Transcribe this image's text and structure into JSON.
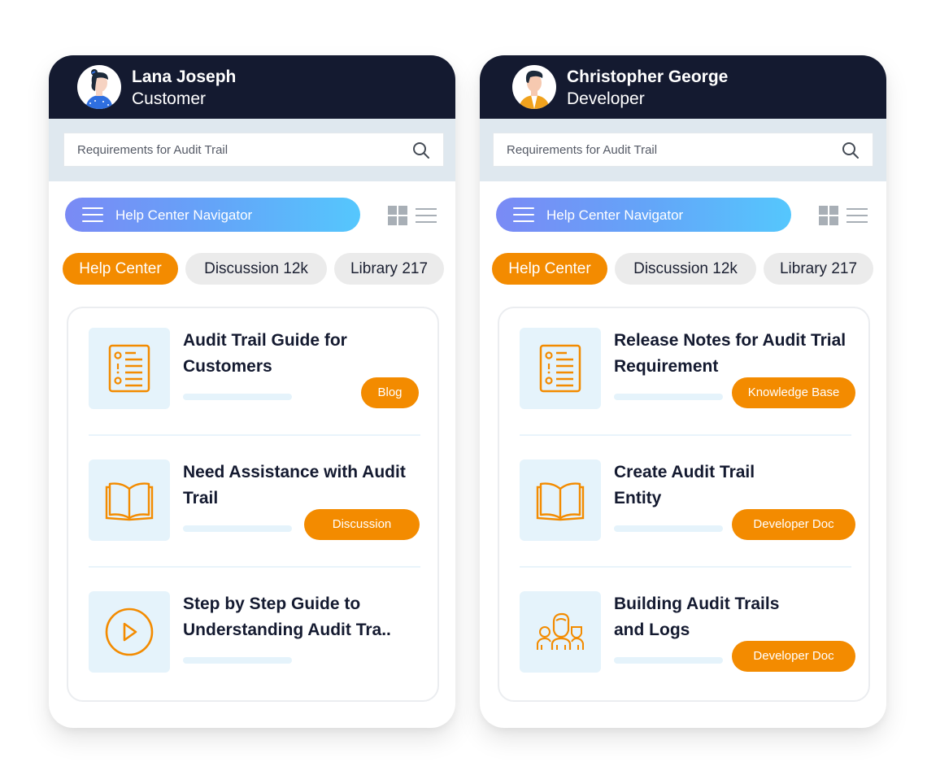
{
  "colors": {
    "header_bg": "#141a30",
    "accent": "#f38b00",
    "search_band": "#dfe8ef",
    "thumb_bg": "#e5f3fb",
    "nav_gradient_start": "#7a8af5",
    "nav_gradient_end": "#55c7fd"
  },
  "panels": [
    {
      "user": {
        "name": "Lana Joseph",
        "role": "Customer",
        "avatar": "woman-avatar-icon"
      },
      "search": {
        "value": "Requirements for Audit Trail",
        "icon": "search-icon"
      },
      "navigator": {
        "label": "Help Center Navigator",
        "icon": "hamburger-icon"
      },
      "view_toggles": [
        "grid-view-icon",
        "list-view-icon"
      ],
      "tabs": [
        {
          "label": "Help Center",
          "active": true
        },
        {
          "label": "Discussion 12k",
          "active": false
        },
        {
          "label": "Library 217",
          "active": false
        }
      ],
      "items": [
        {
          "title": "Audit Trail Guide for Customers",
          "badge": "Blog",
          "icon": "checklist-icon"
        },
        {
          "title": "Need Assistance with Audit Trail",
          "badge": "Discussion",
          "icon": "open-book-icon"
        },
        {
          "title": "Step by Step Guide to Understanding Audit Tra..",
          "badge": null,
          "icon": "play-circle-icon"
        }
      ]
    },
    {
      "user": {
        "name": "Christopher George",
        "role": "Developer",
        "avatar": "man-avatar-icon"
      },
      "search": {
        "value": "Requirements for Audit Trail",
        "icon": "search-icon"
      },
      "navigator": {
        "label": "Help Center Navigator",
        "icon": "hamburger-icon"
      },
      "view_toggles": [
        "grid-view-icon",
        "list-view-icon"
      ],
      "tabs": [
        {
          "label": "Help Center",
          "active": true
        },
        {
          "label": "Discussion 12k",
          "active": false
        },
        {
          "label": "Library 217",
          "active": false
        }
      ],
      "items": [
        {
          "title": "Release Notes for Audit Trial Requirement",
          "badge": "Knowledge Base",
          "icon": "checklist-icon"
        },
        {
          "title": "Create Audit Trail Entity",
          "badge": "Developer Doc",
          "icon": "open-book-icon"
        },
        {
          "title": "Building Audit Trails and Logs",
          "badge": "Developer Doc",
          "icon": "team-icon"
        }
      ]
    }
  ]
}
